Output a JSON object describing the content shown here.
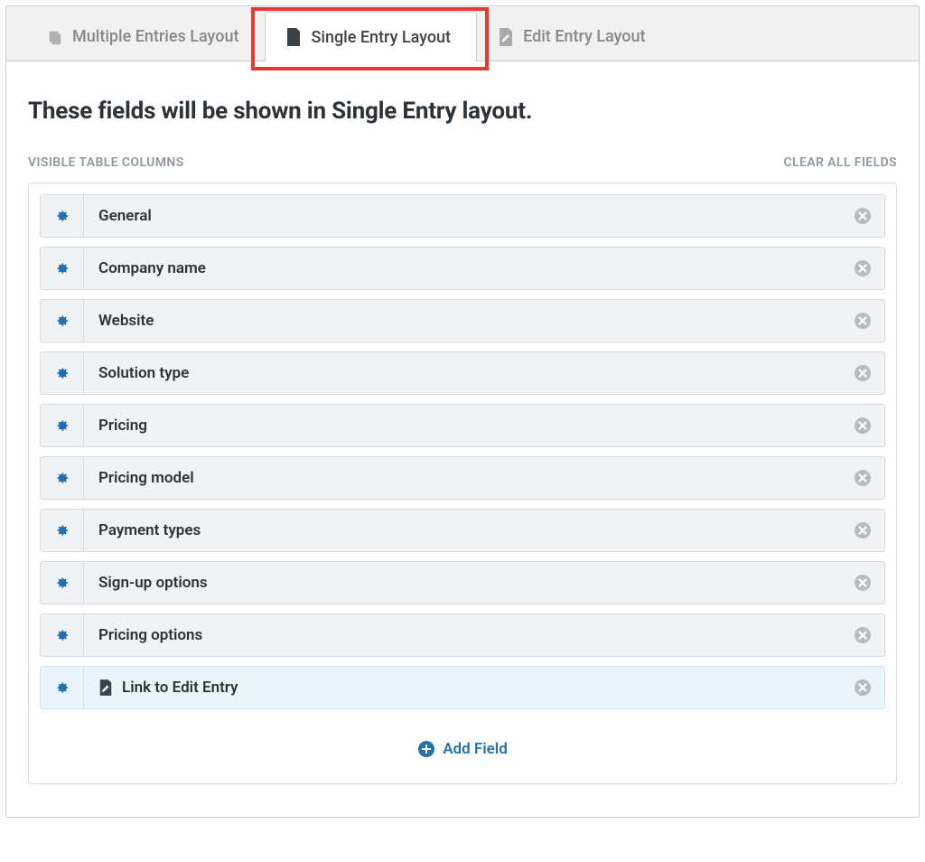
{
  "tabs": {
    "multiple": "Multiple Entries Layout",
    "single": "Single Entry Layout",
    "edit": "Edit Entry Layout"
  },
  "main": {
    "title": "These fields will be shown in Single Entry layout.",
    "section_label": "VISIBLE TABLE COLUMNS",
    "clear_label": "CLEAR ALL FIELDS",
    "add_field_label": "Add Field"
  },
  "fields": [
    {
      "label": "General",
      "special": false,
      "icon": null
    },
    {
      "label": "Company name",
      "special": false,
      "icon": null
    },
    {
      "label": "Website",
      "special": false,
      "icon": null
    },
    {
      "label": "Solution type",
      "special": false,
      "icon": null
    },
    {
      "label": "Pricing",
      "special": false,
      "icon": null
    },
    {
      "label": "Pricing model",
      "special": false,
      "icon": null
    },
    {
      "label": "Payment types",
      "special": false,
      "icon": null
    },
    {
      "label": "Sign-up options",
      "special": false,
      "icon": null
    },
    {
      "label": "Pricing options",
      "special": false,
      "icon": null
    },
    {
      "label": "Link to Edit Entry",
      "special": true,
      "icon": "edit"
    }
  ]
}
